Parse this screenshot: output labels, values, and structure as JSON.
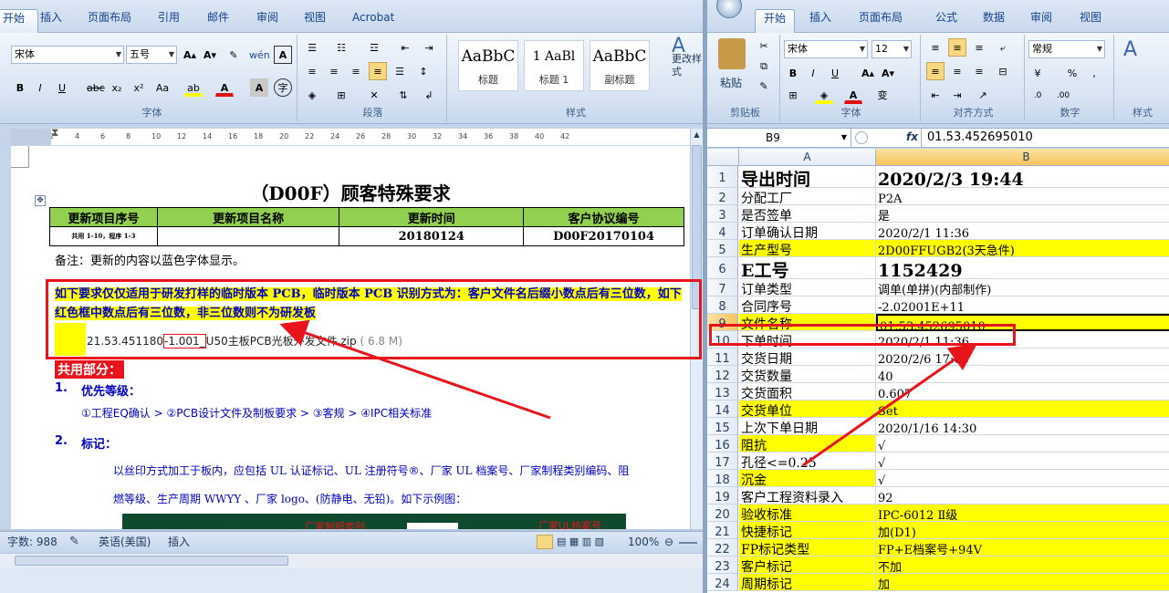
{
  "word": {
    "tabs": [
      "开始",
      "插入",
      "页面布局",
      "引用",
      "邮件",
      "审阅",
      "视图",
      "Acrobat"
    ],
    "font_name": "宋体",
    "font_size": "五号",
    "groups": [
      "字体",
      "段落",
      "样式"
    ],
    "styles": [
      {
        "preview": "AaBbC",
        "name": "标题"
      },
      {
        "preview": "1  AaBl",
        "name": "标题 1"
      },
      {
        "preview": "AaBbC",
        "name": "副标题"
      }
    ],
    "change_styles": "更改样式",
    "ruler_ticks": [
      "2",
      "2",
      "4",
      "6",
      "8",
      "10",
      "12",
      "14",
      "16",
      "18",
      "20",
      "22",
      "24",
      "26",
      "28",
      "30",
      "32",
      "34",
      "36",
      "38",
      "40",
      "42"
    ],
    "doc": {
      "title": "（D00F）顾客特殊要求",
      "table_headers": [
        "更新项目序号",
        "更新项目名称",
        "更新时间",
        "客户协议编号"
      ],
      "table_row": [
        "共用 1-10，程序 1-3",
        "",
        "20180124",
        "D00F20170104"
      ],
      "note": "备注：更新的内容以蓝色字体显示。",
      "highlight_para": "如下要求仅仅适用于研发打样的临时版本 PCB，临时版本 PCB 识别方式为：客户文件名后缀小数点后有三位数，如下红色框中数点后有三位数，非三位数则不为研发板",
      "file_name_pre": "21.53.451180",
      "file_name_mid": "-1.001_",
      "file_name_post": "U50主板PCB光板外发文件.zip",
      "file_size": "( 6.8 M)",
      "section": "共用部分：",
      "item1_num": "1.",
      "item1_title": "优先等级：",
      "item1_body": "①工程EQ确认 > ②PCB设计文件及制板要求 > ③客规 > ④IPC相关标准",
      "item2_num": "2.",
      "item2_title": "标记：",
      "item2_body1": "以丝印方式加工于板内，应包括 UL 认证标记、UL 注册符号®、厂家 UL 档案号、厂家制程类别编码、阻",
      "item2_body2": "燃等级、生产周期 WWYY 、厂家 logo、(防静电、无铅)。如下示例图：",
      "image_label1": "厂家制程类别",
      "image_label2": "厂家UL档案号"
    },
    "status": {
      "words": "字数: 988",
      "language": "英语(美国)",
      "mode": "插入",
      "zoom": "100%"
    }
  },
  "excel": {
    "tabs": [
      "开始",
      "插入",
      "页面布局",
      "公式",
      "数据",
      "审阅",
      "视图"
    ],
    "font_name": "宋体",
    "font_size": "12",
    "number_format": "常规",
    "groups": [
      "剪贴板",
      "字体",
      "对齐方式",
      "数字",
      "样式"
    ],
    "paste": "粘贴",
    "cell_ref": "B9",
    "fx": "fx",
    "formula": "01.53.452695010",
    "col_a": "A",
    "col_b": "B",
    "rows": [
      {
        "n": "1",
        "a": "导出时间",
        "b": "2020/2/3 19:44",
        "big": true
      },
      {
        "n": "2",
        "a": "分配工厂",
        "b": "P2A"
      },
      {
        "n": "3",
        "a": "是否签单",
        "b": "是"
      },
      {
        "n": "4",
        "a": "订单确认日期",
        "b": "2020/2/1 11:36"
      },
      {
        "n": "5",
        "a": "生产型号",
        "b": "2D00FFUGB2(3天急件)",
        "ya": true,
        "yb": true
      },
      {
        "n": "6",
        "a": "E工号",
        "b": "1152429",
        "big": true
      },
      {
        "n": "7",
        "a": "订单类型",
        "b": "调单(单拼)(内部制作)"
      },
      {
        "n": "8",
        "a": "合同序号",
        "b": "-2.02001E+11"
      },
      {
        "n": "9",
        "a": "文件名称",
        "b": "01.53.452695010",
        "ya": true,
        "yb": true
      },
      {
        "n": "10",
        "a": "下单时间",
        "b": "2020/2/1 11:36"
      },
      {
        "n": "11",
        "a": "交货日期",
        "b": "2020/2/6 17:00"
      },
      {
        "n": "12",
        "a": "交货数量",
        "b": "40"
      },
      {
        "n": "13",
        "a": "交货面积",
        "b": "0.607"
      },
      {
        "n": "14",
        "a": "交货单位",
        "b": "Set",
        "ya": true,
        "yb": true
      },
      {
        "n": "15",
        "a": "上次下单日期",
        "b": "2020/1/16 14:30"
      },
      {
        "n": "16",
        "a": "阻抗",
        "b": "√",
        "ya": true
      },
      {
        "n": "17",
        "a": "孔径<=0.25",
        "b": "√"
      },
      {
        "n": "18",
        "a": "沉金",
        "b": "√",
        "ya": true
      },
      {
        "n": "19",
        "a": "客户工程资料录入",
        "b": "92"
      },
      {
        "n": "20",
        "a": "验收标准",
        "b": "IPC-6012 Ⅱ级",
        "ya": true,
        "yb": true
      },
      {
        "n": "21",
        "a": "快捷标记",
        "b": "加(D1)",
        "ya": true,
        "yb": true
      },
      {
        "n": "22",
        "a": "FP标记类型",
        "b": "FP+E档案号+94V",
        "ya": true,
        "yb": true
      },
      {
        "n": "23",
        "a": "客户标记",
        "b": "不加",
        "ya": true,
        "yb": true
      },
      {
        "n": "24",
        "a": "周期标记",
        "b": "加",
        "ya": true,
        "yb": true
      }
    ]
  }
}
